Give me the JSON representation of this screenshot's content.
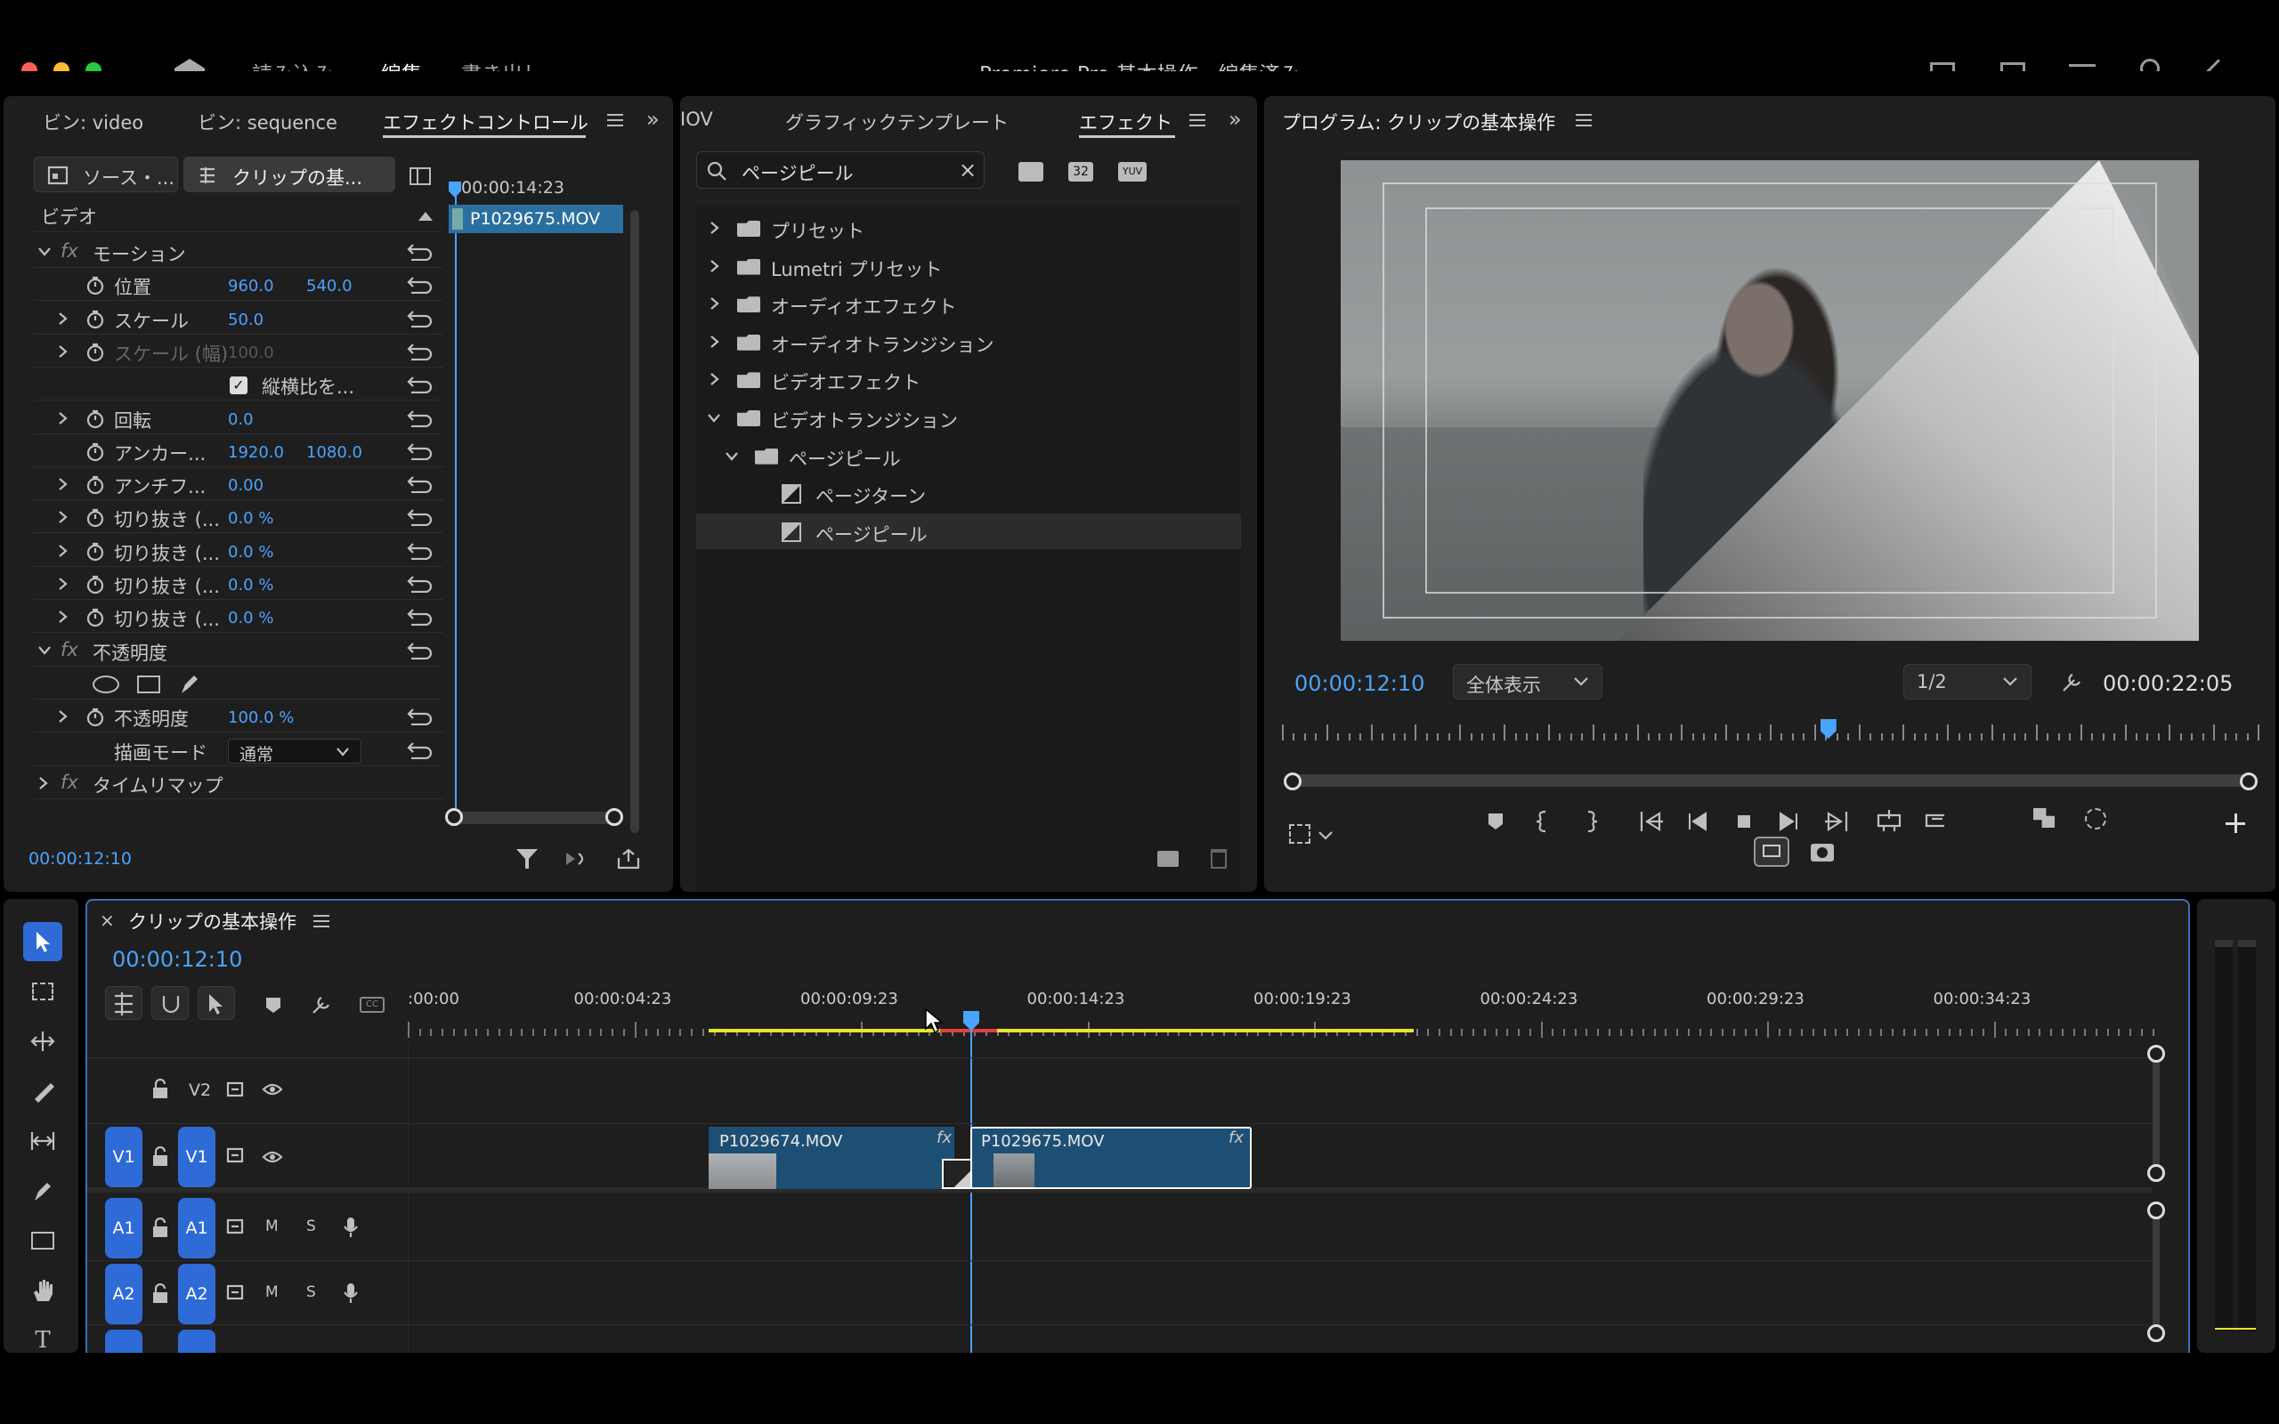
{
  "titlebar": {
    "tab_import": "読み込み",
    "tab_edit": "編集",
    "tab_export": "書き出し",
    "title": "Premiere Pro 基本操作 - 編集済み"
  },
  "effect_controls": {
    "tabs": [
      "ビン: video",
      "ビン: sequence",
      "エフェクトコントロール"
    ],
    "source_btn": "ソース・...",
    "clip_btn": "クリップの基...",
    "timecode_top": "00:00:14:23",
    "clip_name": "P1029675.MOV",
    "section_video": "ビデオ",
    "motion": "モーション",
    "position": {
      "label": "位置",
      "x": "960.0",
      "y": "540.0"
    },
    "scale": {
      "label": "スケール",
      "value": "50.0"
    },
    "scale_width": {
      "label": "スケール (幅)",
      "value": "100.0"
    },
    "uniform_scale": "縦横比を...",
    "rotation": {
      "label": "回転",
      "value": "0.0"
    },
    "anchor": {
      "label": "アンカー...",
      "x": "1920.0",
      "y": "1080.0"
    },
    "antiflicker": {
      "label": "アンチフ...",
      "value": "0.00"
    },
    "crop": [
      {
        "label": "切り抜き (...",
        "value": "0.0 %"
      },
      {
        "label": "切り抜き (...",
        "value": "0.0 %"
      },
      {
        "label": "切り抜き (...",
        "value": "0.0 %"
      },
      {
        "label": "切り抜き (...",
        "value": "0.0 %"
      }
    ],
    "opacity_section": "不透明度",
    "opacity": {
      "label": "不透明度",
      "value": "100.0 %"
    },
    "blend_mode": {
      "label": "描画モード",
      "value": "通常"
    },
    "time_remap": "タイムリマップ",
    "timecode_bottom": "00:00:12:10"
  },
  "effects_panel": {
    "tabs": [
      "IOV",
      "グラフィックテンプレート",
      "エフェクト"
    ],
    "search_value": "ページピール",
    "items": [
      {
        "label": "プリセット"
      },
      {
        "label": "Lumetri プリセット"
      },
      {
        "label": "オーディオエフェクト"
      },
      {
        "label": "オーディオトランジション"
      },
      {
        "label": "ビデオエフェクト"
      },
      {
        "label": "ビデオトランジション"
      },
      {
        "label": "ページピール"
      },
      {
        "label": "ページターン"
      },
      {
        "label": "ページピール"
      }
    ]
  },
  "program_monitor": {
    "title": "プログラム: クリップの基本操作",
    "timecode": "00:00:12:10",
    "zoom": "全体表示",
    "resolution": "1/2",
    "duration": "00:00:22:05",
    "playhead_fraction": 0.56
  },
  "timeline": {
    "tab": "クリップの基本操作",
    "timecode": "00:00:12:10",
    "ruler": [
      ":00:00",
      "00:00:04:23",
      "00:00:09:23",
      "00:00:14:23",
      "00:00:19:23",
      "00:00:24:23",
      "00:00:29:23",
      "00:00:34:23"
    ],
    "tracks": {
      "v2": "V2",
      "v1_src": "V1",
      "v1": "V1",
      "a1_src": "A1",
      "a1": "A1",
      "a2_src": "A2",
      "a2": "A2",
      "mute": "M",
      "solo": "S"
    },
    "clip1": "P1029674.MOV",
    "clip2": "P1029675.MOV",
    "fx": "fx"
  },
  "colors": {
    "accent_blue": "#4aa3ff",
    "clip_blue": "#1d4f74",
    "track_button": "#2f6bd6",
    "work_area_yellow": "#e6e62a"
  }
}
